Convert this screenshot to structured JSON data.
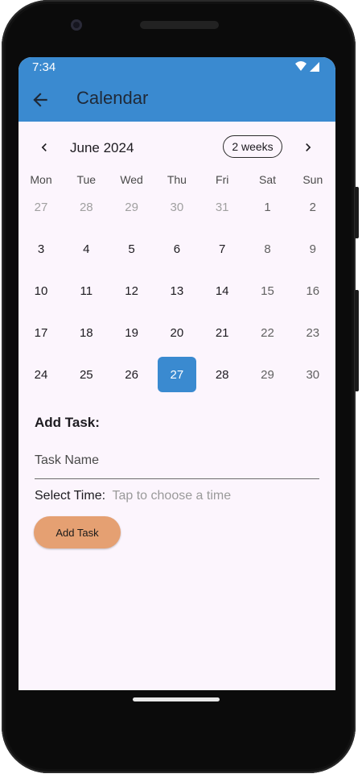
{
  "status_bar": {
    "time": "7:34"
  },
  "app_bar": {
    "title": "Calendar",
    "back_icon": "arrow-left-icon"
  },
  "calendar": {
    "month_label": "June 2024",
    "format_button": "2 weeks",
    "weekdays": [
      "Mon",
      "Tue",
      "Wed",
      "Thu",
      "Fri",
      "Sat",
      "Sun"
    ],
    "weeks": [
      [
        "27",
        "28",
        "29",
        "30",
        "31",
        "1",
        "2"
      ],
      [
        "3",
        "4",
        "5",
        "6",
        "7",
        "8",
        "9"
      ],
      [
        "10",
        "11",
        "12",
        "13",
        "14",
        "15",
        "16"
      ],
      [
        "17",
        "18",
        "19",
        "20",
        "21",
        "22",
        "23"
      ],
      [
        "24",
        "25",
        "26",
        "27",
        "28",
        "29",
        "30"
      ]
    ],
    "outside_days_first_week": 5,
    "selected_day": "27",
    "selected_color": "#3a8ad0"
  },
  "add_task": {
    "title": "Add Task:",
    "task_name_placeholder": "Task Name",
    "time_label": "Select Time:",
    "time_placeholder": "Tap to choose a time",
    "button_label": "Add Task",
    "button_color": "#e5a072"
  },
  "colors": {
    "app_bar": "#3a8ad0",
    "background": "#fcf5fd"
  }
}
